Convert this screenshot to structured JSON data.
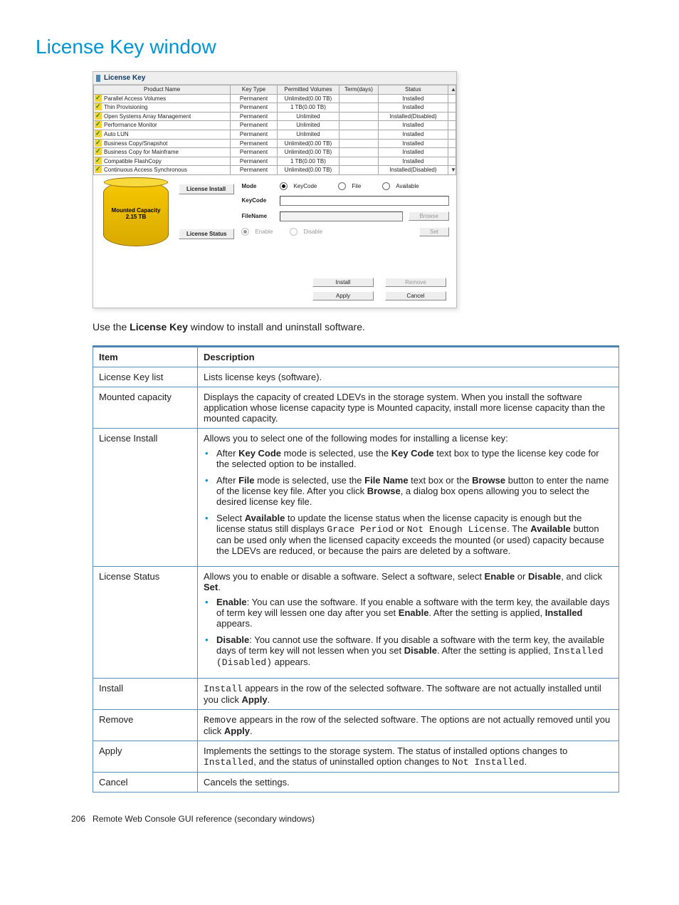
{
  "heading": "License Key window",
  "screenshot": {
    "title": "License Key",
    "cols": {
      "productName": "Product Name",
      "keyType": "Key Type",
      "permitted": "Permitted Volumes",
      "term": "Term(days)",
      "status": "Status"
    },
    "rows": [
      {
        "name": "Parallel Access Volumes",
        "kt": "Permanent",
        "pv": "Unlimited(0.00 TB)",
        "term": "",
        "status": "Installed"
      },
      {
        "name": "Thin Provisioning",
        "kt": "Permanent",
        "pv": "1 TB(0.00 TB)",
        "term": "",
        "status": "Installed"
      },
      {
        "name": "Open Systems Array Management",
        "kt": "Permanent",
        "pv": "Unlimited",
        "term": "",
        "status": "Installed(Disabled)"
      },
      {
        "name": "Performance Monitor",
        "kt": "Permanent",
        "pv": "Unlimited",
        "term": "",
        "status": "Installed"
      },
      {
        "name": "Auto LUN",
        "kt": "Permanent",
        "pv": "Unlimited",
        "term": "",
        "status": "Installed"
      },
      {
        "name": "Business Copy/Snapshot",
        "kt": "Permanent",
        "pv": "Unlimited(0.00 TB)",
        "term": "",
        "status": "Installed"
      },
      {
        "name": "Business Copy for Mainframe",
        "kt": "Permanent",
        "pv": "Unlimited(0.00 TB)",
        "term": "",
        "status": "Installed"
      },
      {
        "name": "Compatible FlashCopy",
        "kt": "Permanent",
        "pv": "1 TB(0.00 TB)",
        "term": "",
        "status": "Installed"
      },
      {
        "name": "Continuous Access Synchronous",
        "kt": "Permanent",
        "pv": "Unlimited(0.00 TB)",
        "term": "",
        "status": "Installed(Disabled)"
      }
    ],
    "mountedLabel": "Mounted Capacity",
    "mountedValue": "2.15 TB",
    "licenseInstallBtn": "License Install",
    "licenseStatusBtn": "License Status",
    "modeLabel": "Mode",
    "modeOpts": {
      "keycode": "KeyCode",
      "file": "File",
      "available": "Available"
    },
    "keycodeLabel": "KeyCode",
    "filenameLabel": "FileName",
    "browse": "Browse",
    "enable": "Enable",
    "disable": "Disable",
    "set": "Set",
    "install": "Install",
    "remove": "Remove",
    "apply": "Apply",
    "cancel": "Cancel"
  },
  "intro": {
    "pre": "Use the ",
    "bold": "License Key",
    "post": " window to install and uninstall software."
  },
  "docTable": {
    "headItem": "Item",
    "headDesc": "Description",
    "rows": [
      {
        "item": "License Key list",
        "plain": "Lists license keys (software)."
      },
      {
        "item": "Mounted capacity",
        "plain": "Displays the capacity of created LDEVs in the storage system. When you install the software application whose license capacity type is Mounted capacity, install more license capacity than the mounted capacity."
      },
      {
        "item": "License Install",
        "lead": "Allows you to select one of the following modes for installing a license key:",
        "bullets": [
          {
            "segs": [
              {
                "t": "After "
              },
              {
                "b": "Key Code"
              },
              {
                "t": " mode is selected, use the "
              },
              {
                "b": "Key Code"
              },
              {
                "t": " text box to type the license key code for the selected option to be installed."
              }
            ]
          },
          {
            "segs": [
              {
                "t": "After "
              },
              {
                "b": "File"
              },
              {
                "t": " mode is selected, use the "
              },
              {
                "b": "File Name"
              },
              {
                "t": " text box or the "
              },
              {
                "b": "Browse"
              },
              {
                "t": " button to enter the name of the license key file. After you click "
              },
              {
                "b": "Browse"
              },
              {
                "t": ", a dialog box opens allowing you to select the desired license key file."
              }
            ]
          },
          {
            "segs": [
              {
                "t": "Select "
              },
              {
                "b": "Available"
              },
              {
                "t": " to update the license status when the license capacity is enough but the license status still displays "
              },
              {
                "m": "Grace Period"
              },
              {
                "t": " or "
              },
              {
                "m": "Not Enough License"
              },
              {
                "t": ". The "
              },
              {
                "b": "Available"
              },
              {
                "t": " button can be used only when the licensed capacity exceeds the mounted (or used) capacity because the LDEVs are reduced, or because the pairs are deleted by a software."
              }
            ]
          }
        ]
      },
      {
        "item": "License Status",
        "lead": "Allows you to enable or disable a software. Select a software, select Enable or Disable, and click Set.",
        "leadSegs": [
          {
            "t": "Allows you to enable or disable a software. Select a software, select "
          },
          {
            "b": "Enable"
          },
          {
            "t": " or "
          },
          {
            "b": "Disable"
          },
          {
            "t": ", and click "
          },
          {
            "b": "Set"
          },
          {
            "t": "."
          }
        ],
        "bullets": [
          {
            "segs": [
              {
                "b": "Enable"
              },
              {
                "t": ": You can use the software. If you enable a software with the term key, the available days of term key will lessen one day after you set "
              },
              {
                "b": "Enable"
              },
              {
                "t": ". After the setting is applied, "
              },
              {
                "b": "Installed"
              },
              {
                "t": " appears."
              }
            ]
          },
          {
            "segs": [
              {
                "b": "Disable"
              },
              {
                "t": ": You cannot use the software. If you disable a software with the term key, the available days of term key will not lessen when you set "
              },
              {
                "b": "Disable"
              },
              {
                "t": ". After the setting is applied, "
              },
              {
                "m": "Installed (Disabled)"
              },
              {
                "t": " appears."
              }
            ]
          }
        ]
      },
      {
        "item": "Install",
        "segs": [
          {
            "m": "Install"
          },
          {
            "t": " appears in the row of the selected software. The software are not actually installed until you click "
          },
          {
            "b": "Apply"
          },
          {
            "t": "."
          }
        ]
      },
      {
        "item": "Remove",
        "segs": [
          {
            "m": "Remove"
          },
          {
            "t": " appears in the row of the selected software. The options are not actually removed until you click "
          },
          {
            "b": "Apply"
          },
          {
            "t": "."
          }
        ]
      },
      {
        "item": "Apply",
        "segs": [
          {
            "t": "Implements the settings to the storage system. The status of installed options changes to "
          },
          {
            "m": "Installed"
          },
          {
            "t": ", and the status of uninstalled option changes to "
          },
          {
            "m": "Not Installed"
          },
          {
            "t": "."
          }
        ]
      },
      {
        "item": "Cancel",
        "plain": "Cancels the settings."
      }
    ]
  },
  "footer": {
    "pageNum": "206",
    "text": "Remote Web Console GUI reference (secondary windows)"
  }
}
